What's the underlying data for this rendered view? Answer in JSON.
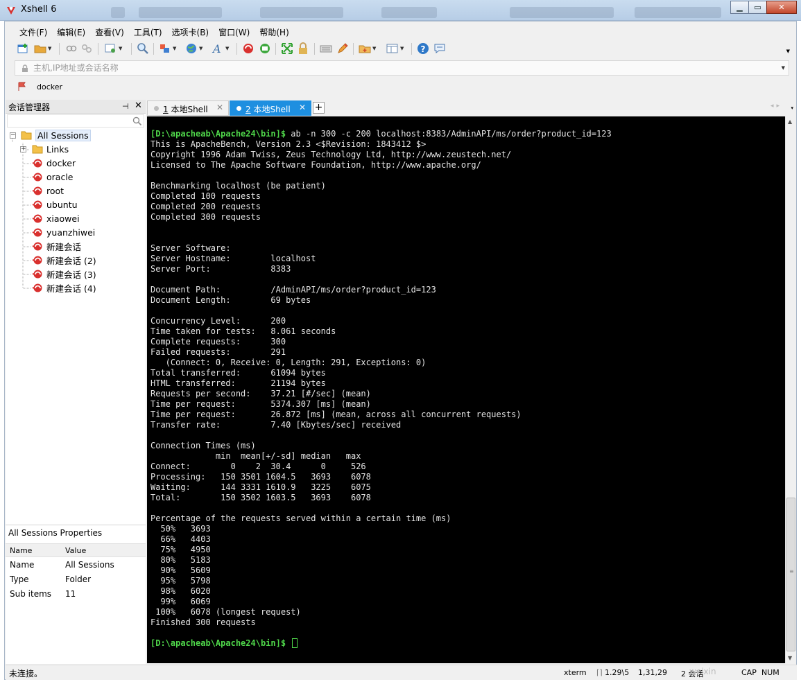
{
  "window": {
    "title": "Xshell 6",
    "brand_color": "#d9302e"
  },
  "menu": [
    {
      "label": "文件(F)"
    },
    {
      "label": "编辑(E)"
    },
    {
      "label": "查看(V)"
    },
    {
      "label": "工具(T)"
    },
    {
      "label": "选项卡(B)"
    },
    {
      "label": "窗口(W)"
    },
    {
      "label": "帮助(H)"
    }
  ],
  "address": {
    "placeholder": "主机,IP地址或会话名称"
  },
  "quick_command": {
    "label": "docker"
  },
  "session_manager": {
    "title": "会话管理器",
    "pin_glyph": "⊣",
    "close_glyph": "✕",
    "tree": [
      {
        "label": "All Sessions",
        "icon": "folder-icon",
        "selected": true
      },
      {
        "label": "Links",
        "icon": "folder-icon"
      },
      {
        "label": "docker",
        "icon": "session-icon"
      },
      {
        "label": "oracle",
        "icon": "session-icon"
      },
      {
        "label": "root",
        "icon": "session-icon"
      },
      {
        "label": "ubuntu",
        "icon": "session-icon"
      },
      {
        "label": "xiaowei",
        "icon": "session-icon"
      },
      {
        "label": "yuanzhiwei",
        "icon": "session-icon"
      },
      {
        "label": "新建会话",
        "icon": "session-icon"
      },
      {
        "label": "新建会话 (2)",
        "icon": "session-icon"
      },
      {
        "label": "新建会话 (3)",
        "icon": "session-icon"
      },
      {
        "label": "新建会话 (4)",
        "icon": "session-icon"
      }
    ]
  },
  "properties": {
    "title": "All Sessions Properties",
    "headers": [
      "Name",
      "Value"
    ],
    "rows": [
      {
        "key": "Name",
        "value": "All Sessions"
      },
      {
        "key": "Type",
        "value": "Folder"
      },
      {
        "key": "Sub items",
        "value": "11"
      }
    ]
  },
  "tabs": [
    {
      "num": "1",
      "label": " 本地Shell",
      "active": false
    },
    {
      "num": "2",
      "label": " 本地Shell",
      "active": true
    }
  ],
  "tab_controls": {
    "add": "+",
    "close": "✕",
    "nav": "◂▸",
    "menu": "▾"
  },
  "terminal": {
    "prompt_color": "#4fd64a",
    "lines": [
      {
        "prompt": "[D:\\apacheab\\Apache24\\bin]$",
        "text": " ab -n 300 -c 200 localhost:8383/AdminAPI/ms/order?product_id=123"
      },
      {
        "text": "This is ApacheBench, Version 2.3 <$Revision: 1843412 $>"
      },
      {
        "text": "Copyright 1996 Adam Twiss, Zeus Technology Ltd, http://www.zeustech.net/"
      },
      {
        "text": "Licensed to The Apache Software Foundation, http://www.apache.org/"
      },
      {
        "text": ""
      },
      {
        "text": "Benchmarking localhost (be patient)"
      },
      {
        "text": "Completed 100 requests"
      },
      {
        "text": "Completed 200 requests"
      },
      {
        "text": "Completed 300 requests"
      },
      {
        "text": ""
      },
      {
        "text": ""
      },
      {
        "text": "Server Software:"
      },
      {
        "text": "Server Hostname:        localhost"
      },
      {
        "text": "Server Port:            8383"
      },
      {
        "text": ""
      },
      {
        "text": "Document Path:          /AdminAPI/ms/order?product_id=123"
      },
      {
        "text": "Document Length:        69 bytes"
      },
      {
        "text": ""
      },
      {
        "text": "Concurrency Level:      200"
      },
      {
        "text": "Time taken for tests:   8.061 seconds"
      },
      {
        "text": "Complete requests:      300"
      },
      {
        "text": "Failed requests:        291"
      },
      {
        "text": "   (Connect: 0, Receive: 0, Length: 291, Exceptions: 0)"
      },
      {
        "text": "Total transferred:      61094 bytes"
      },
      {
        "text": "HTML transferred:       21194 bytes"
      },
      {
        "text": "Requests per second:    37.21 [#/sec] (mean)"
      },
      {
        "text": "Time per request:       5374.307 [ms] (mean)"
      },
      {
        "text": "Time per request:       26.872 [ms] (mean, across all concurrent requests)"
      },
      {
        "text": "Transfer rate:          7.40 [Kbytes/sec] received"
      },
      {
        "text": ""
      },
      {
        "text": "Connection Times (ms)"
      },
      {
        "text": "             min  mean[+/-sd] median   max"
      },
      {
        "text": "Connect:        0    2  30.4      0     526"
      },
      {
        "text": "Processing:   150 3501 1604.5   3693    6078"
      },
      {
        "text": "Waiting:      144 3331 1610.9   3225    6075"
      },
      {
        "text": "Total:        150 3502 1603.5   3693    6078"
      },
      {
        "text": ""
      },
      {
        "text": "Percentage of the requests served within a certain time (ms)"
      },
      {
        "text": "  50%   3693"
      },
      {
        "text": "  66%   4403"
      },
      {
        "text": "  75%   4950"
      },
      {
        "text": "  80%   5183"
      },
      {
        "text": "  90%   5609"
      },
      {
        "text": "  95%   5798"
      },
      {
        "text": "  98%   6020"
      },
      {
        "text": "  99%   6069"
      },
      {
        "text": " 100%   6078 (longest request)"
      },
      {
        "text": "Finished 300 requests"
      },
      {
        "text": ""
      },
      {
        "prompt": "[D:\\apacheab\\Apache24\\bin]$",
        "text": " ",
        "cursor": true
      }
    ]
  },
  "statusbar": {
    "left": "未连接。",
    "term": "xterm",
    "size": "1.29\\5",
    "pos": "1,31,29",
    "sessions": "2 会话",
    "caps": "CAP",
    "num": "NUM",
    "watermark": "weixin"
  }
}
